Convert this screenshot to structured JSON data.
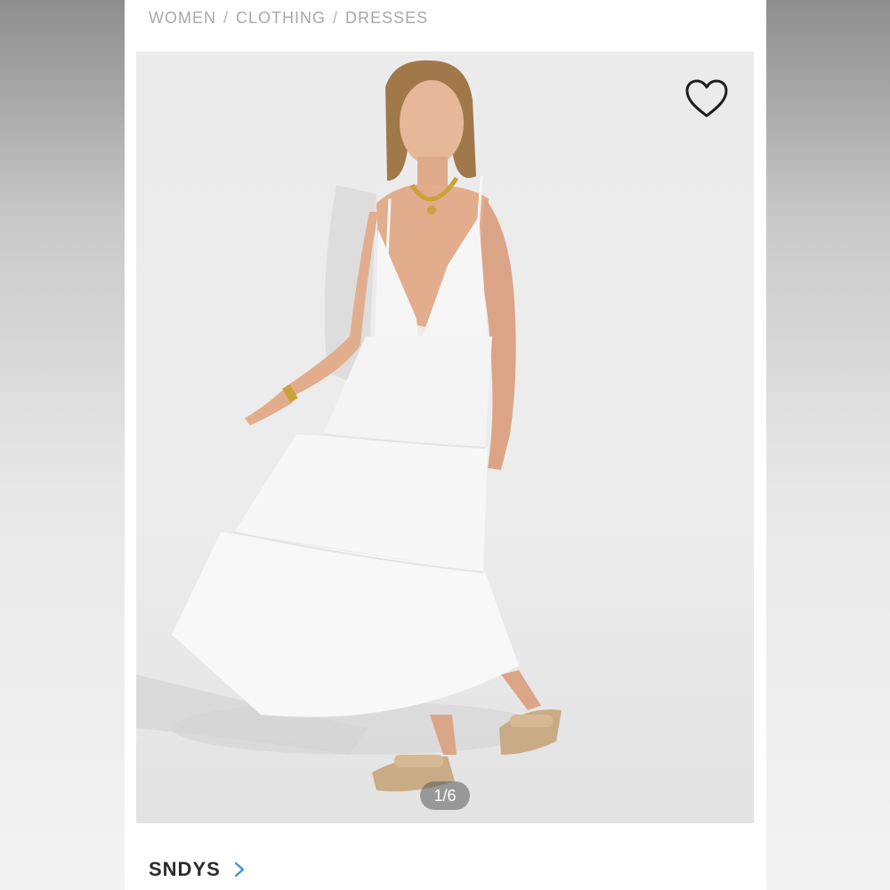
{
  "breadcrumb": {
    "items": [
      "WOMEN",
      "CLOTHING",
      "DRESSES"
    ],
    "separator": "/"
  },
  "gallery": {
    "counter": "1/6",
    "favorite_icon": "heart-outline-icon"
  },
  "brand": {
    "name": "SNDYS",
    "chevron_icon": "chevron-right-icon",
    "chevron_color": "#3a8fd6"
  }
}
